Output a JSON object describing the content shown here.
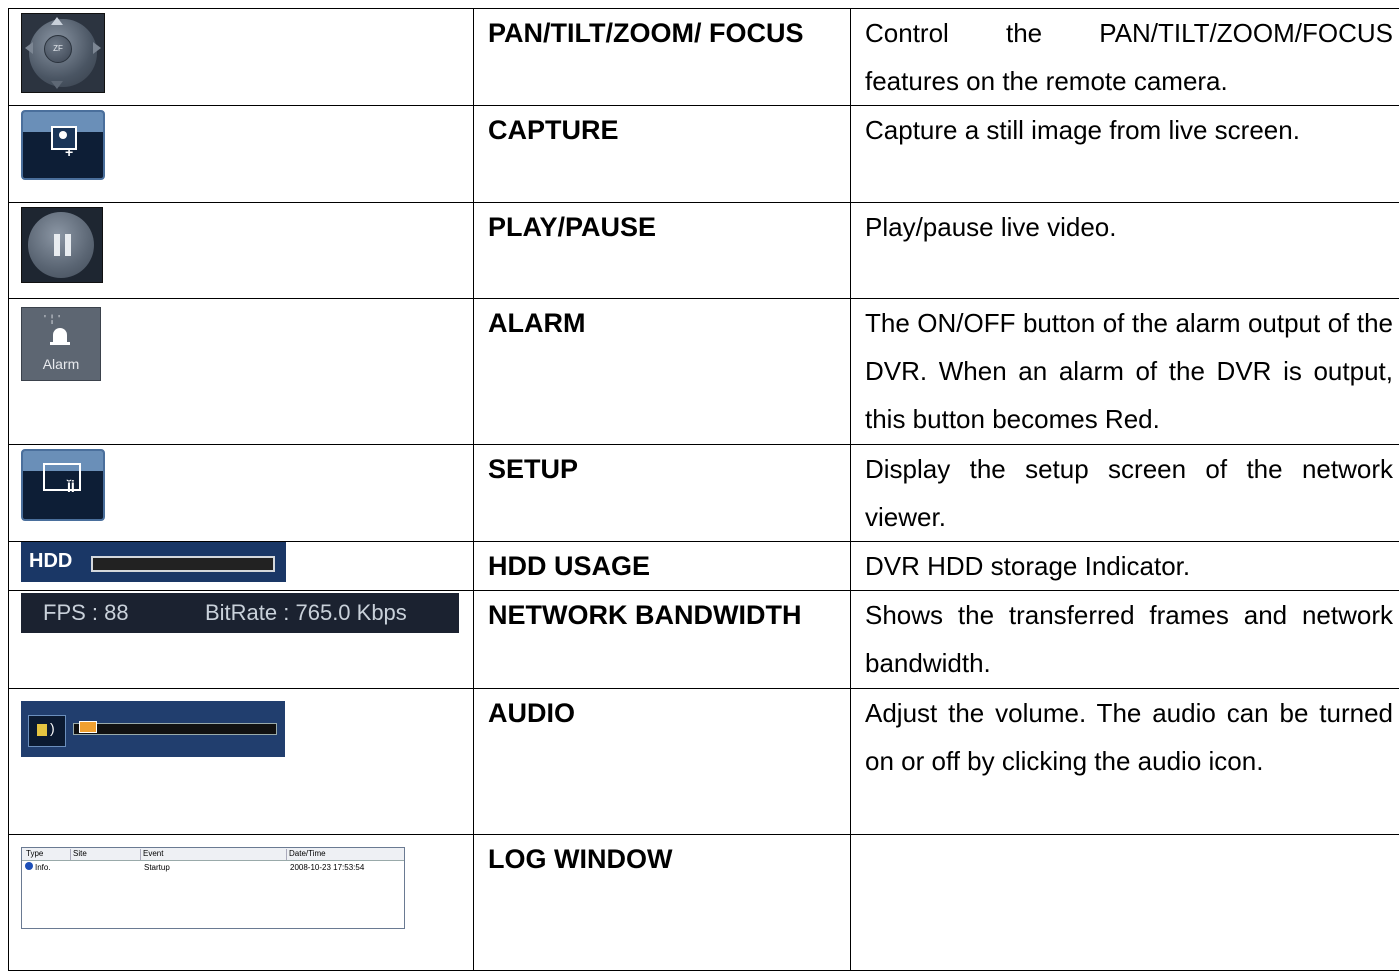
{
  "rows": [
    {
      "name": "PAN/TILT/ZOOM/ FOCUS",
      "desc": "Control the PAN/TILT/ZOOM/FOCUS features on the remote camera.",
      "icon": "ptz-control-icon"
    },
    {
      "name": "CAPTURE",
      "desc": "Capture a still image from live screen.",
      "icon": "capture-icon"
    },
    {
      "name": "PLAY/PAUSE",
      "desc": "Play/pause live video.",
      "icon": "pause-icon"
    },
    {
      "name": "ALARM",
      "desc": "The ON/OFF button of the alarm output of the DVR. When an alarm of the DVR is output, this button becomes Red.",
      "icon": "alarm-icon"
    },
    {
      "name": "SETUP",
      "desc": "Display the setup screen of the network viewer.",
      "icon": "setup-icon"
    },
    {
      "name": "HDD USAGE",
      "desc": "DVR HDD storage Indicator.",
      "icon": "hdd-usage-icon"
    },
    {
      "name": "NETWORK BANDWIDTH",
      "desc": "Shows the transferred frames and network bandwidth.",
      "icon": "network-bandwidth-icon"
    },
    {
      "name": "AUDIO",
      "desc": "Adjust the volume. The audio can be turned on or off by clicking the audio icon.",
      "icon": "audio-icon"
    },
    {
      "name": "LOG WINDOW",
      "desc": "",
      "icon": "log-window-icon"
    }
  ],
  "icons": {
    "ptz_center": "ZF",
    "alarm_label": "Alarm",
    "hdd_label": "HDD",
    "fps": "FPS : 88",
    "bitrate": "BitRate : 765.0 Kbps",
    "log": {
      "columns": [
        "Type",
        "Site",
        "Event",
        "Date/Time"
      ],
      "row": [
        "Info.",
        "",
        "Startup",
        "2008-10-23 17:53:54"
      ]
    }
  }
}
